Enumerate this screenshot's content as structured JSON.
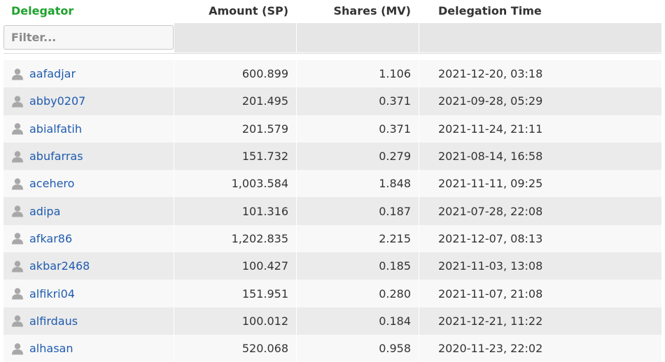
{
  "header": {
    "delegator": "Delegator",
    "amount": "Amount (SP)",
    "shares": "Shares (MV)",
    "time": "Delegation Time"
  },
  "filter": {
    "placeholder": "Filter..."
  },
  "colors": {
    "header_accent": "#1fa22e",
    "link": "#1f5bb0"
  },
  "rows": [
    {
      "name": "aafadjar",
      "amount": "600.899",
      "shares": "1.106",
      "time": "2021-12-20, 03:18"
    },
    {
      "name": "abby0207",
      "amount": "201.495",
      "shares": "0.371",
      "time": "2021-09-28, 05:29"
    },
    {
      "name": "abialfatih",
      "amount": "201.579",
      "shares": "0.371",
      "time": "2021-11-24, 21:11"
    },
    {
      "name": "abufarras",
      "amount": "151.732",
      "shares": "0.279",
      "time": "2021-08-14, 16:58"
    },
    {
      "name": "acehero",
      "amount": "1,003.584",
      "shares": "1.848",
      "time": "2021-11-11, 09:25"
    },
    {
      "name": "adipa",
      "amount": "101.316",
      "shares": "0.187",
      "time": "2021-07-28, 22:08"
    },
    {
      "name": "afkar86",
      "amount": "1,202.835",
      "shares": "2.215",
      "time": "2021-12-07, 08:13"
    },
    {
      "name": "akbar2468",
      "amount": "100.427",
      "shares": "0.185",
      "time": "2021-11-03, 13:08"
    },
    {
      "name": "alfikri04",
      "amount": "151.951",
      "shares": "0.280",
      "time": "2021-11-07, 21:08"
    },
    {
      "name": "alfirdaus",
      "amount": "100.012",
      "shares": "0.184",
      "time": "2021-12-21, 11:22"
    },
    {
      "name": "alhasan",
      "amount": "520.068",
      "shares": "0.958",
      "time": "2020-11-23, 22:02"
    }
  ]
}
